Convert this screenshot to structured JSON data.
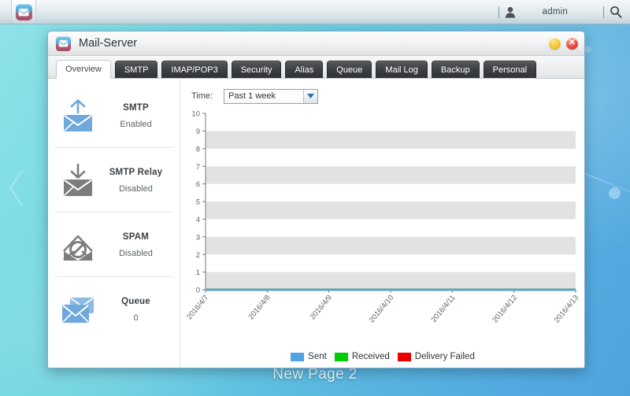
{
  "taskbar": {
    "app_icon": "mail-app-icon",
    "user_icon": "user-icon",
    "user_name": "admin",
    "search_icon": "search-icon"
  },
  "window": {
    "icon": "mail-app-icon",
    "title": "Mail-Server",
    "minimize_label": "",
    "close_label": "✕"
  },
  "tabs": [
    {
      "label": "Overview",
      "active": true
    },
    {
      "label": "SMTP",
      "active": false
    },
    {
      "label": "IMAP/POP3",
      "active": false
    },
    {
      "label": "Security",
      "active": false
    },
    {
      "label": "Alias",
      "active": false
    },
    {
      "label": "Queue",
      "active": false
    },
    {
      "label": "Mail Log",
      "active": false
    },
    {
      "label": "Backup",
      "active": false
    },
    {
      "label": "Personal",
      "active": false
    }
  ],
  "sidebar": {
    "items": [
      {
        "title": "SMTP",
        "status": "Enabled",
        "icon": "envelope-up-arrow-icon",
        "color": "#6ea8dc"
      },
      {
        "title": "SMTP Relay",
        "status": "Disabled",
        "icon": "envelope-down-arrow-icon",
        "color": "#7d7d7d"
      },
      {
        "title": "SPAM",
        "status": "Disabled",
        "icon": "envelope-no-entry-icon",
        "color": "#7d7d7d"
      },
      {
        "title": "Queue",
        "status": "0",
        "icon": "stacked-envelopes-icon",
        "color": "#6ea8dc"
      }
    ]
  },
  "controls": {
    "time_label": "Time:",
    "time_value": "Past 1 week",
    "time_options": [
      "Past 1 week"
    ],
    "dropdown_icon": "chevron-down-icon"
  },
  "chart_data": {
    "type": "line",
    "title": "",
    "xlabel": "",
    "ylabel": "",
    "categories": [
      "2016/4/7",
      "2016/4/8",
      "2016/4/9",
      "2016/4/10",
      "2016/4/11",
      "2016/4/12",
      "2016/4/13"
    ],
    "yticks": [
      0,
      1,
      2,
      3,
      4,
      5,
      6,
      7,
      8,
      9,
      10
    ],
    "ylim": [
      0,
      10
    ],
    "grid": "horizontal-alternating-bands",
    "band_ranges": [
      [
        0,
        1
      ],
      [
        2,
        3
      ],
      [
        4,
        5
      ],
      [
        6,
        7
      ],
      [
        8,
        9
      ]
    ],
    "legend_position": "bottom-center",
    "series": [
      {
        "name": "Sent",
        "color": "#4fa3e3",
        "values": [
          0,
          0,
          0,
          0,
          0,
          0,
          0
        ]
      },
      {
        "name": "Received",
        "color": "#00cc00",
        "values": [
          0,
          0,
          0,
          0,
          0,
          0,
          0
        ]
      },
      {
        "name": "Delivery Failed",
        "color": "#ee0000",
        "values": [
          0,
          0,
          0,
          0,
          0,
          0,
          0
        ]
      }
    ]
  },
  "caption": "New Page 2"
}
